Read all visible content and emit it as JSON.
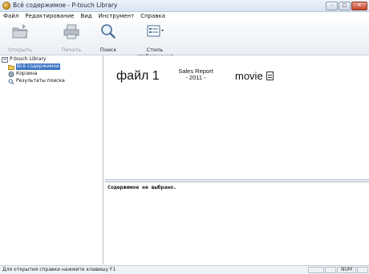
{
  "window": {
    "title": "Всё содержимое - P-touch Library",
    "buttons": {
      "minimize": "–",
      "maximize": "□",
      "close": "✕"
    }
  },
  "menu": [
    "Файл",
    "Редактирование",
    "Вид",
    "Инструмент",
    "Справка"
  ],
  "toolbar": {
    "open": {
      "label": "Открыть",
      "icon": "open-folder-icon",
      "enabled": false
    },
    "print": {
      "label": "Печать",
      "icon": "printer-icon",
      "enabled": false
    },
    "search": {
      "label": "Поиск",
      "icon": "magnifier-icon",
      "enabled": true
    },
    "view_style": {
      "label": "Стиль отображения",
      "icon": "view-style-icon",
      "enabled": true
    }
  },
  "tree": {
    "root": "P-touch Library",
    "items": [
      {
        "label": "Всё содержимое",
        "selected": true,
        "icon": "folder-icon"
      },
      {
        "label": "Корзина",
        "selected": false,
        "icon": "trash-icon"
      },
      {
        "label": "Результаты поиска",
        "selected": false,
        "icon": "search-results-icon"
      }
    ]
  },
  "thumbnails": {
    "file1": "файл 1",
    "sales_line1": "Sales Report",
    "sales_line2": "- 2011 -",
    "movie": "movie"
  },
  "details": {
    "empty_message": "Содержимое не выбрано."
  },
  "statusbar": {
    "help_text": "Для открытия справки нажмите клавишу F1",
    "num": "NUM"
  },
  "colors": {
    "selection": "#3b74c4",
    "title_bar": "#d8e4f2"
  }
}
